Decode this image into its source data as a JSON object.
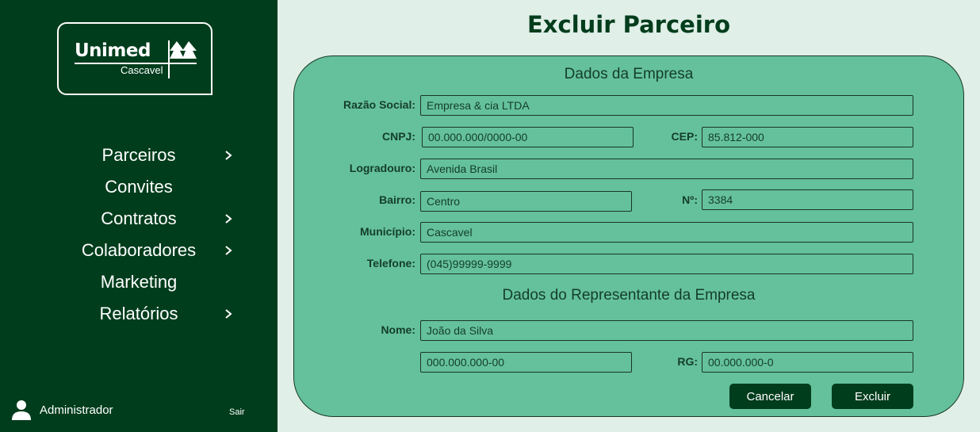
{
  "brand": {
    "name": "Unimed",
    "city": "Cascavel"
  },
  "nav": [
    {
      "label": "Parceiros",
      "has_submenu": true
    },
    {
      "label": "Convites",
      "has_submenu": false
    },
    {
      "label": "Contratos",
      "has_submenu": true
    },
    {
      "label": "Colaboradores",
      "has_submenu": true
    },
    {
      "label": "Marketing",
      "has_submenu": false
    },
    {
      "label": "Relatórios",
      "has_submenu": true
    }
  ],
  "user": {
    "name": "Administrador",
    "logout_label": "Sair",
    "icon": "user-icon"
  },
  "page": {
    "title": "Excluir Parceiro"
  },
  "company": {
    "section_title": "Dados da Empresa",
    "razao_social": {
      "label": "Razão Social:",
      "value": "Empresa & cia LTDA"
    },
    "cnpj": {
      "label": "CNPJ:",
      "value": "00.000.000/0000-00"
    },
    "cep": {
      "label": "CEP:",
      "value": "85.812-000"
    },
    "logradouro": {
      "label": "Logradouro:",
      "value": "Avenida Brasil"
    },
    "bairro": {
      "label": "Bairro:",
      "value": "Centro"
    },
    "numero": {
      "label": "Nº:",
      "value": "3384"
    },
    "municipio": {
      "label": "Município:",
      "value": "Cascavel"
    },
    "telefone": {
      "label": "Telefone:",
      "value": "(045)99999-9999"
    }
  },
  "representative": {
    "section_title": "Dados do Representante da Empresa",
    "nome": {
      "label": "Nome:",
      "value": "João da Silva"
    },
    "cpf": {
      "value": "000.000.000-00"
    },
    "rg": {
      "label": "RG:",
      "value": "00.000.000-0"
    }
  },
  "actions": {
    "cancel_label": "Cancelar",
    "delete_label": "Excluir"
  },
  "colors": {
    "sidebar": "#003d1c",
    "background": "#e0efe7",
    "card": "#64c19b",
    "accent": "#003d1c"
  }
}
